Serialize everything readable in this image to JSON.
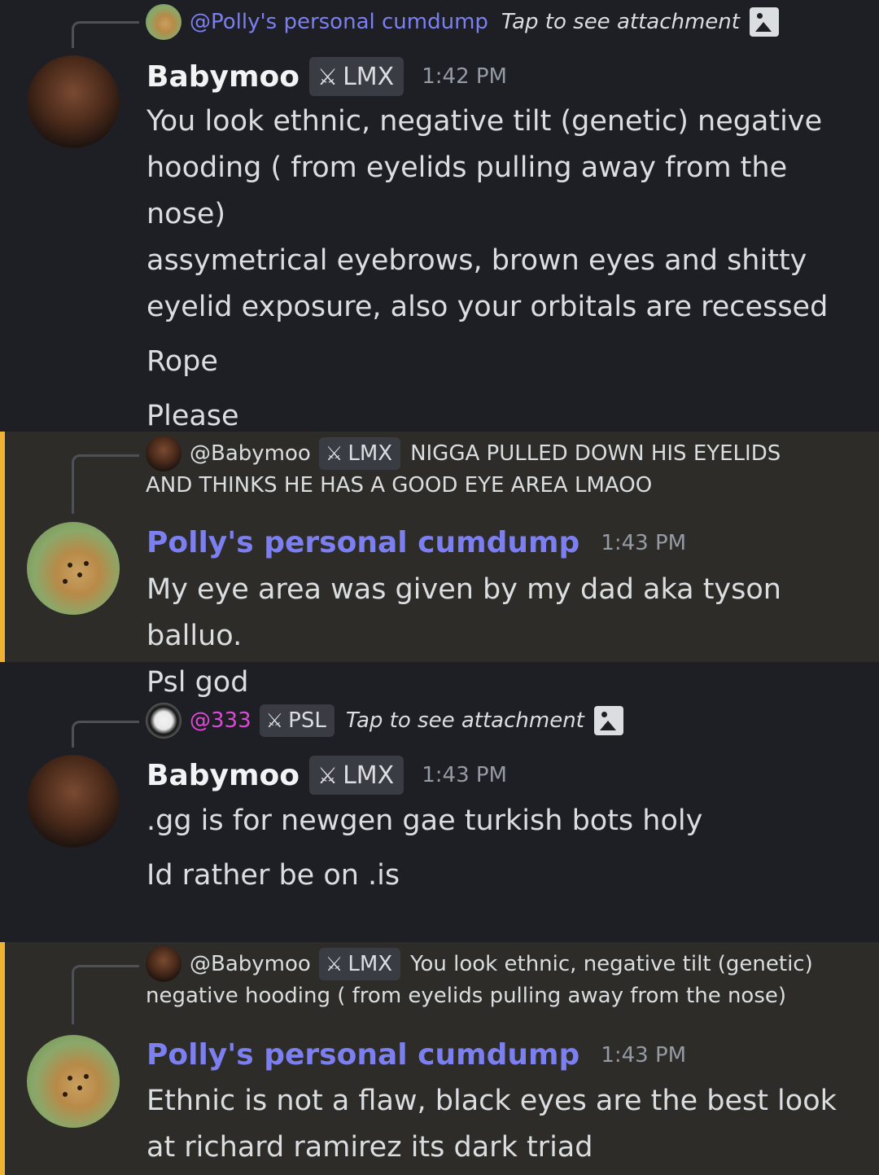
{
  "messages": [
    {
      "reply": {
        "handle": "@Polly's personal cumdump",
        "attachment_text": "Tap to see attachment",
        "avatar_icon": "cheetah-avatar"
      },
      "author": "Babymoo",
      "role": "LMX",
      "time": "1:42 PM",
      "lines": [
        "You look ethnic, negative tilt (genetic) negative",
        "hooding ( from eyelids pulling away from the nose)",
        "assymetrical eyebrows, brown eyes and shitty",
        "eyelid exposure, also your orbitals are recessed",
        "Rope",
        "Please"
      ]
    },
    {
      "reply": {
        "handle": "@Babymoo",
        "role": "LMX",
        "snippet_line1": "NIGGA PULLED DOWN HIS EYELIDS",
        "snippet_line2": "AND THINKS HE HAS A GOOD EYE AREA LMAOO"
      },
      "author": "Polly's personal cumdump",
      "time": "1:43 PM",
      "lines": [
        "My eye area was given by my dad aka tyson balluo.",
        "Psl god"
      ]
    },
    {
      "reply": {
        "handle": "@333",
        "role": "PSL",
        "attachment_text": "Tap to see attachment"
      },
      "author": "Babymoo",
      "role": "LMX",
      "time": "1:43 PM",
      "lines": [
        ".gg is for newgen gae turkish bots holy",
        "Id rather be on .is"
      ]
    },
    {
      "reply": {
        "handle": "@Babymoo",
        "role": "LMX",
        "snippet_line1": "You look ethnic, negative tilt (genetic)",
        "snippet_line2": "negative hooding ( from eyelids pulling away from the nose)"
      },
      "author": "Polly's personal cumdump",
      "time": "1:43 PM",
      "lines": [
        "Ethnic is not a flaw, black eyes are the best look",
        "at richard ramirez its dark triad"
      ]
    }
  ],
  "colors": {
    "background": "#1e1f24",
    "mention_background": "#2d2c28",
    "mention_bar": "#f0b232",
    "blurple": "#7c7ff0",
    "pink": "#e048d8"
  }
}
